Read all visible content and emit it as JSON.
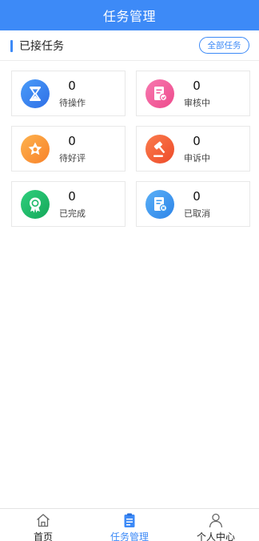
{
  "header": {
    "title": "任务管理"
  },
  "section": {
    "title": "已接任务",
    "all_button": "全部任务"
  },
  "cards": [
    {
      "count": "0",
      "label": "待操作",
      "icon": "hourglass-icon",
      "color": "#3d8af7"
    },
    {
      "count": "0",
      "label": "审核中",
      "icon": "review-doc-icon",
      "color": "#f25c9a"
    },
    {
      "count": "0",
      "label": "待好评",
      "icon": "star-badge-icon",
      "color": "#fb9a3c"
    },
    {
      "count": "0",
      "label": "申诉中",
      "icon": "gavel-icon",
      "color": "#f5603a"
    },
    {
      "count": "0",
      "label": "已完成",
      "icon": "check-badge-icon",
      "color": "#1fba6a"
    },
    {
      "count": "0",
      "label": "已取消",
      "icon": "cancel-doc-icon",
      "color": "#3a9af0"
    }
  ],
  "tabbar": {
    "items": [
      {
        "label": "首页",
        "icon": "home-icon"
      },
      {
        "label": "任务管理",
        "icon": "clipboard-icon",
        "active": true
      },
      {
        "label": "个人中心",
        "icon": "user-icon"
      }
    ],
    "active_color": "#3d8af7"
  }
}
